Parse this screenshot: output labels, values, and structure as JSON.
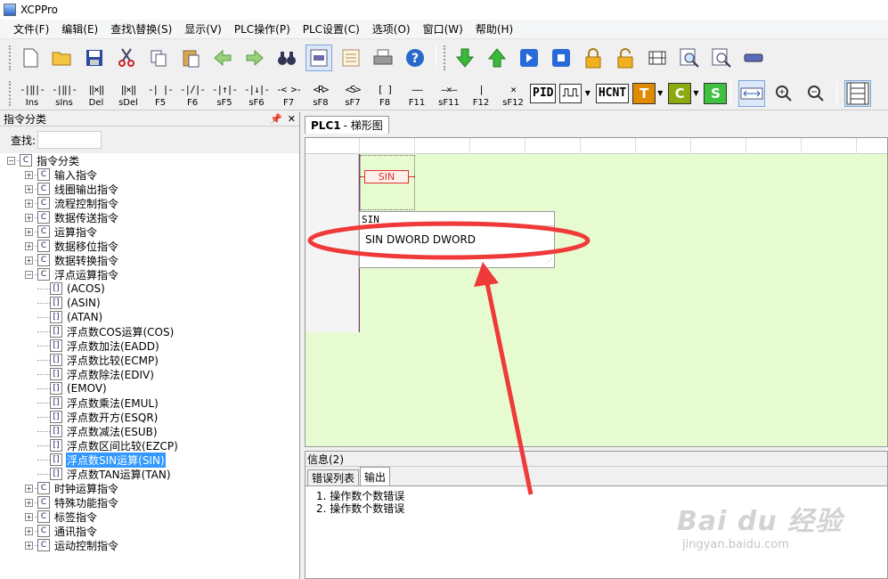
{
  "window": {
    "title": "XCPPro"
  },
  "menu": [
    "文件(F)",
    "编辑(E)",
    "查找\\替换(S)",
    "显示(V)",
    "PLC操作(P)",
    "PLC设置(C)",
    "选项(O)",
    "窗口(W)",
    "帮助(H)"
  ],
  "toolbar1": {
    "icons": [
      "new-file-icon",
      "open-folder-icon",
      "save-icon",
      "cut-icon",
      "copy-icon",
      "paste-icon",
      "undo-arrow-icon",
      "redo-arrow-icon",
      "binoculars-icon",
      "ladder-view-icon",
      "list-view-icon",
      "print-icon",
      "help-icon",
      "download-icon",
      "upload-icon",
      "run-icon",
      "stop-icon",
      "lock-icon",
      "unlock-icon",
      "monitor-icon",
      "zoom-doc-icon",
      "search-doc-icon",
      "comm-icon"
    ]
  },
  "toolbar2": {
    "ladder_buttons": [
      {
        "sym": "-|‖|-",
        "label": "Ins"
      },
      {
        "sym": "-|‖|-",
        "label": "sIns"
      },
      {
        "sym": "‖×‖",
        "label": "Del"
      },
      {
        "sym": "‖×‖",
        "label": "sDel"
      },
      {
        "sym": "-| |-",
        "label": "F5"
      },
      {
        "sym": "-|/|-",
        "label": "F6"
      },
      {
        "sym": "-|↑|-",
        "label": "sF5"
      },
      {
        "sym": "-|↓|-",
        "label": "sF6"
      },
      {
        "sym": "-< >-",
        "label": "F7"
      },
      {
        "sym": "<R>",
        "label": "sF8"
      },
      {
        "sym": "<S>",
        "label": "sF7"
      },
      {
        "sym": "[ ]",
        "label": "F8"
      },
      {
        "sym": "——",
        "label": "F11"
      },
      {
        "sym": "—×—",
        "label": "sF11"
      },
      {
        "sym": "|",
        "label": "F12"
      },
      {
        "sym": "×",
        "label": "sF12"
      }
    ],
    "boxes": [
      "PID",
      "⎍⎍",
      "HCNT"
    ],
    "color_buttons": [
      {
        "text": "T",
        "color": "#e08a00"
      },
      {
        "text": "C",
        "color": "#8aaa10"
      },
      {
        "text": "S",
        "color": "#40c040"
      }
    ]
  },
  "left_panel": {
    "title": "指令分类",
    "search_label": "查找:",
    "search_value": "",
    "tree": [
      {
        "level": 0,
        "exp": "-",
        "label": "指令分类"
      },
      {
        "level": 1,
        "exp": "+",
        "label": "输入指令"
      },
      {
        "level": 1,
        "exp": "+",
        "label": "线圈输出指令"
      },
      {
        "level": 1,
        "exp": "+",
        "label": "流程控制指令"
      },
      {
        "level": 1,
        "exp": "+",
        "label": "数据传送指令"
      },
      {
        "level": 1,
        "exp": "+",
        "label": "运算指令"
      },
      {
        "level": 1,
        "exp": "+",
        "label": "数据移位指令"
      },
      {
        "level": 1,
        "exp": "+",
        "label": "数据转换指令"
      },
      {
        "level": 1,
        "exp": "-",
        "label": "浮点运算指令"
      },
      {
        "level": 2,
        "exp": "",
        "label": "(ACOS)"
      },
      {
        "level": 2,
        "exp": "",
        "label": "(ASIN)"
      },
      {
        "level": 2,
        "exp": "",
        "label": "(ATAN)"
      },
      {
        "level": 2,
        "exp": "",
        "label": "浮点数COS运算(COS)"
      },
      {
        "level": 2,
        "exp": "",
        "label": "浮点数加法(EADD)"
      },
      {
        "level": 2,
        "exp": "",
        "label": "浮点数比较(ECMP)"
      },
      {
        "level": 2,
        "exp": "",
        "label": "浮点数除法(EDIV)"
      },
      {
        "level": 2,
        "exp": "",
        "label": "(EMOV)"
      },
      {
        "level": 2,
        "exp": "",
        "label": "浮点数乘法(EMUL)"
      },
      {
        "level": 2,
        "exp": "",
        "label": "浮点数开方(ESQR)"
      },
      {
        "level": 2,
        "exp": "",
        "label": "浮点数减法(ESUB)"
      },
      {
        "level": 2,
        "exp": "",
        "label": "浮点数区间比较(EZCP)"
      },
      {
        "level": 2,
        "exp": "",
        "label": "浮点数SIN运算(SIN)",
        "selected": true
      },
      {
        "level": 2,
        "exp": "",
        "label": "浮点数TAN运算(TAN)"
      },
      {
        "level": 1,
        "exp": "+",
        "label": "时钟运算指令"
      },
      {
        "level": 1,
        "exp": "+",
        "label": "特殊功能指令"
      },
      {
        "level": 1,
        "exp": "+",
        "label": "标签指令"
      },
      {
        "level": 1,
        "exp": "+",
        "label": "通讯指令"
      },
      {
        "level": 1,
        "exp": "+",
        "label": "运动控制指令"
      }
    ]
  },
  "editor": {
    "tab_label": "PLC1",
    "tab_sub": "- 梯形图",
    "block_label": "SIN",
    "popup_title": "SIN",
    "popup_signature": "SIN DWORD DWORD",
    "background": "#e6fcd0"
  },
  "info_panel": {
    "header": "信息(2)",
    "tabs": [
      "错误列表",
      "输出"
    ],
    "active_tab": 1,
    "lines": [
      "1. 操作数个数错误",
      "2. 操作数个数错误"
    ]
  },
  "annotation": {
    "color": "#f03a3a"
  },
  "watermark": {
    "logo": "Bai du 经验",
    "url": "jingyan.baidu.com"
  }
}
